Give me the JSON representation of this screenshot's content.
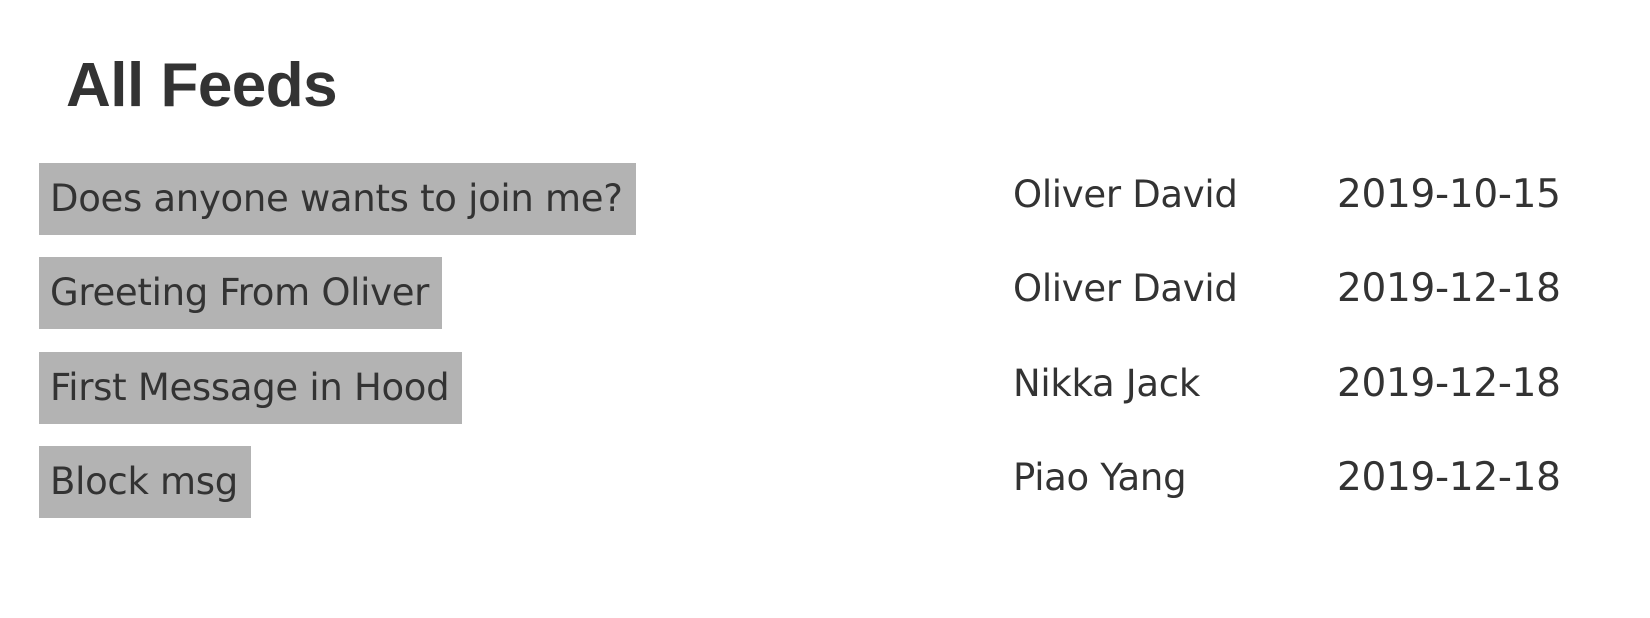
{
  "page": {
    "title": "All Feeds"
  },
  "feeds": [
    {
      "title": "Does anyone wants to join me?",
      "author": "Oliver David",
      "date": "2019-10-15"
    },
    {
      "title": "Greeting From Oliver",
      "author": "Oliver David",
      "date": "2019-12-18"
    },
    {
      "title": "First Message in Hood",
      "author": "Nikka Jack",
      "date": "2019-12-18"
    },
    {
      "title": "Block msg",
      "author": "Piao Yang",
      "date": "2019-12-18"
    }
  ],
  "colors": {
    "text": "#333333",
    "title_highlight": "#b3b3b3",
    "background": "#ffffff"
  }
}
